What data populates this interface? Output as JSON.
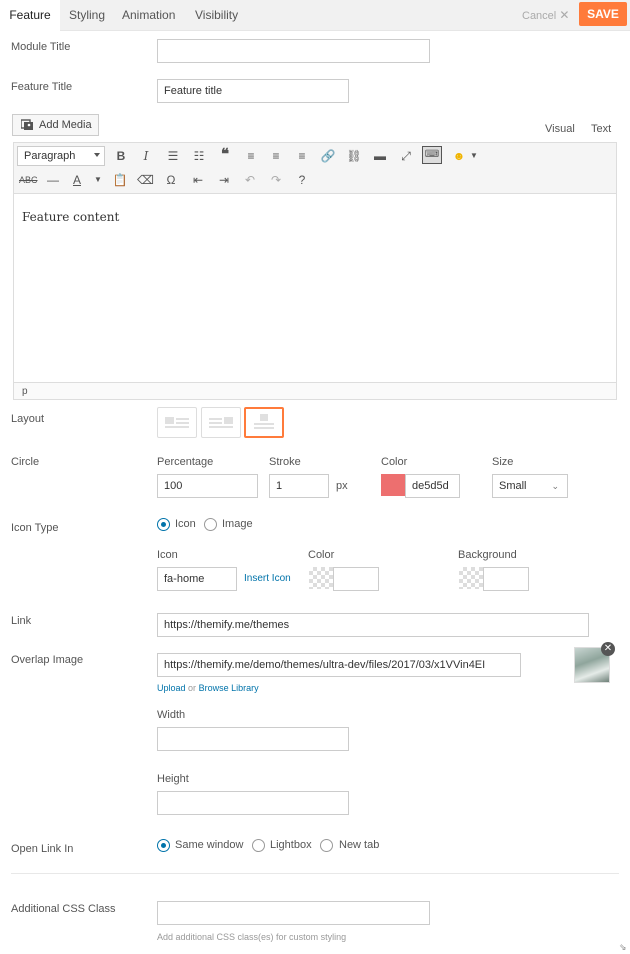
{
  "tabs": [
    {
      "label": "Feature",
      "active": true
    },
    {
      "label": "Styling"
    },
    {
      "label": "Animation"
    },
    {
      "label": "Visibility"
    }
  ],
  "actions": {
    "cancel": "Cancel",
    "save": "SAVE"
  },
  "module_title": {
    "label": "Module Title",
    "value": ""
  },
  "feature_title": {
    "label": "Feature Title",
    "value": "Feature title"
  },
  "editor": {
    "add_media": "Add Media",
    "mode_visual": "Visual",
    "mode_text": "Text",
    "format_select": "Paragraph",
    "content": "Feature content",
    "status_path": "p"
  },
  "layout": {
    "label": "Layout",
    "selected_index": 2
  },
  "circle": {
    "label": "Circle",
    "percentage_label": "Percentage",
    "percentage": "100",
    "stroke_label": "Stroke",
    "stroke": "1",
    "stroke_unit": "px",
    "color_label": "Color",
    "color": "de5d5d",
    "color_hex": "#ed6f6f",
    "size_label": "Size",
    "size": "Small"
  },
  "icon_type": {
    "label": "Icon Type",
    "options": [
      "Icon",
      "Image"
    ],
    "selected": "Icon",
    "icon_label": "Icon",
    "icon_value": "fa-home",
    "insert_icon": "Insert Icon",
    "color_label": "Color",
    "background_label": "Background"
  },
  "link": {
    "label": "Link",
    "value": "https://themify.me/themes"
  },
  "overlap_image": {
    "label": "Overlap Image",
    "value": "https://themify.me/demo/themes/ultra-dev/files/2017/03/x1VVin4EI",
    "upload": "Upload",
    "or": "or",
    "browse": "Browse Library",
    "width_label": "Width",
    "width": "",
    "height_label": "Height",
    "height": ""
  },
  "open_link_in": {
    "label": "Open Link In",
    "options": [
      "Same window",
      "Lightbox",
      "New tab"
    ],
    "selected": "Same window"
  },
  "css_class": {
    "label": "Additional CSS Class",
    "value": "",
    "hint": "Add additional CSS class(es) for custom styling"
  },
  "colors": {
    "accent": "#ff7b3b",
    "link": "#0073aa"
  }
}
